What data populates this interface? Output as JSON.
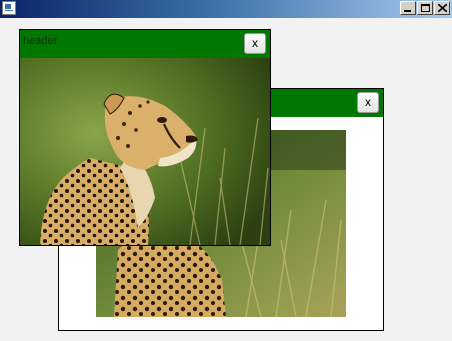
{
  "window": {
    "icon": "app-icon",
    "controls": [
      "minimize-icon",
      "maximize-icon",
      "close-icon"
    ]
  },
  "subwindows": [
    {
      "title": "",
      "close_label": "x",
      "image": "cheetah-photo"
    },
    {
      "title": "header",
      "close_label": "x",
      "image": "cheetah-photo"
    }
  ],
  "colors": {
    "header_bg": "#007700",
    "title_bar_start": "#0a246a",
    "title_bar_end": "#a6caf0",
    "desktop_bg": "#f2f2f2"
  }
}
